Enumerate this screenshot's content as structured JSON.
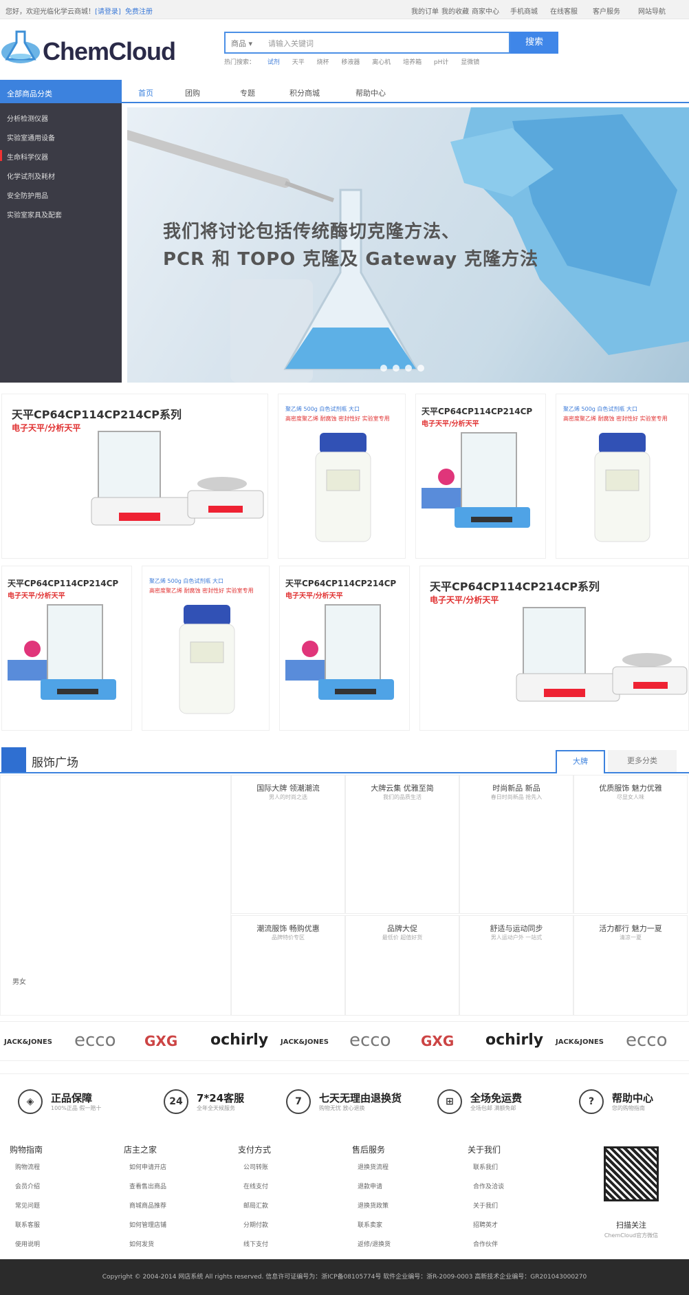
{
  "topbar": {
    "left1": "您好，欢迎光临化学云商城！",
    "left2": "[请登录]",
    "left3": "免费注册",
    "links": [
      "我的订单",
      "我的收藏",
      "商家中心",
      "手机商城",
      "在线客服",
      "客户服务",
      "网站导航"
    ]
  },
  "header": {
    "logo": "ChemCloud",
    "search_select": "商品",
    "search_placeholder": "请输入关键词",
    "search_button": "搜索",
    "hot_label": "热门搜索：",
    "hot_words": [
      "试剂",
      "天平",
      "烧杯",
      "移液器",
      "离心机",
      "培养箱",
      "pH计",
      "显微镜"
    ]
  },
  "nav": {
    "category_title": "全部商品分类",
    "links": [
      "首页",
      "团购",
      "专题",
      "积分商城",
      "帮助中心"
    ]
  },
  "sidebar": {
    "items": [
      "分析检测仪器",
      "实验室通用设备",
      "生命科学仪器",
      "化学试剂及耗材",
      "安全防护用品",
      "实验室家具及配套"
    ]
  },
  "banner": {
    "line1": "我们将讨论包括传统酶切克隆方法、",
    "line2": "PCR 和 TOPO 克隆及 Gateway 克隆方法"
  },
  "products": {
    "balance_title": "天平CP64CP114CP214CP系列",
    "balance_sub": "电子天平/分析天平",
    "balance_title_short": "天平CP64CP114CP214CP",
    "bottle_line1": "聚乙烯 500g 白色试剂瓶 大口",
    "bottle_line2": "高密度聚乙烯 耐腐蚀 密封性好 实验室专用"
  },
  "brands": {
    "section_title": "服饰广场",
    "tab_big": "大牌",
    "tab_all": "更多分类",
    "left_label": "男女",
    "cells": [
      {
        "name": "国际大牌 领潮潮流",
        "desc": "男人的时尚之选"
      },
      {
        "name": "大牌云集 优雅至简",
        "desc": "我们的品质生活"
      },
      {
        "name": "时尚新品 新品",
        "desc": "春日时尚新品 抢先入"
      },
      {
        "name": "优质服饰 魅力优雅",
        "desc": "尽显女人味"
      },
      {
        "name": "潮流服饰 畅购优惠",
        "desc": "品牌特价专区"
      },
      {
        "name": "品牌大促",
        "desc": "最低价 超值好货"
      },
      {
        "name": "舒适与运动同步",
        "desc": "男人运动户外 一站式"
      },
      {
        "name": "活力都行 魅力一夏",
        "desc": "清凉一夏"
      }
    ]
  },
  "logo_strip": [
    "JACK&JONES",
    "ecco",
    "GXG",
    "ochirly",
    "JACK&JONES",
    "ecco",
    "GXG",
    "ochirly",
    "JACK&JONES",
    "ecco"
  ],
  "services": [
    {
      "icon": "shield-icon",
      "glyph": "◈",
      "title": "正品保障",
      "sub": "100%正品 假一赔十"
    },
    {
      "icon": "clock-icon",
      "glyph": "24",
      "title": "7*24客服",
      "sub": "全年全天候服务"
    },
    {
      "icon": "return-icon",
      "glyph": "7",
      "title": "七天无理由退换货",
      "sub": "购物无忧 放心退换"
    },
    {
      "icon": "gift-icon",
      "glyph": "⊞",
      "title": "全场免运费",
      "sub": "全场包邮 满额免邮"
    },
    {
      "icon": "help-icon",
      "glyph": "?",
      "title": "帮助中心",
      "sub": "您的购物指南"
    }
  ],
  "footer": {
    "columns": [
      {
        "title": "购物指南",
        "links": [
          "购物流程",
          "会员介绍",
          "常见问题",
          "联系客服",
          "使用说明"
        ]
      },
      {
        "title": "店主之家",
        "links": [
          "如何申请开店",
          "查看售出商品",
          "商城商品推荐",
          "如何管理店铺",
          "如何发货"
        ]
      },
      {
        "title": "支付方式",
        "links": [
          "公司转账",
          "在线支付",
          "邮局汇款",
          "分期付款",
          "线下支付"
        ]
      },
      {
        "title": "售后服务",
        "links": [
          "退换货流程",
          "退款申请",
          "退换货政策",
          "联系卖家",
          "返修/退换货"
        ]
      },
      {
        "title": "关于我们",
        "links": [
          "联系我们",
          "合作及洽谈",
          "关于我们",
          "招聘英才",
          "合作伙伴"
        ]
      }
    ],
    "qr_label": "扫描关注",
    "qr_sub": "ChemCloud官方微信",
    "copyright": "Copyright © 2004-2014 网店系统 All rights reserved. 信息许可证编号为：浙ICP备08105774号  软件企业编号：浙R-2009-0003  高新技术企业编号：GR201043000270"
  }
}
